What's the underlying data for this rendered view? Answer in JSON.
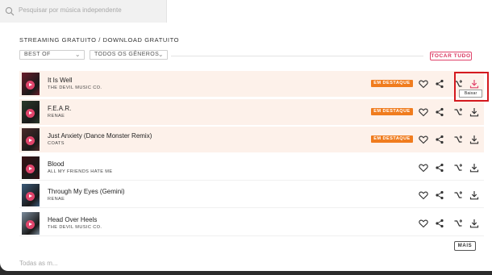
{
  "search": {
    "placeholder": "Pesquisar por música independente"
  },
  "section": {
    "title": "STREAMING GRATUITO / DOWNLOAD GRATUITO"
  },
  "filters": {
    "sort": "BEST OF",
    "genre": "TODOS OS GÊNEROS"
  },
  "play_all_label": "TOCAR TUDO",
  "featured_label": "EM DESTAQUE",
  "tooltip_label": "Baixar",
  "more_label": "MAIS",
  "footer_peek": "Todas as m...",
  "accent_color": "#e0446b",
  "badge_color": "#f07c1e",
  "tracks": [
    {
      "title": "It Is Well",
      "artist": "THE DEVIL MUSIC CO.",
      "featured": true,
      "thumb_color": "#6b1d2a"
    },
    {
      "title": "F.E.A.R.",
      "artist": "RENAE",
      "featured": true,
      "thumb_color": "#2a3a2a"
    },
    {
      "title": "Just Anxiety (Dance Monster Remix)",
      "artist": "COATS",
      "featured": true,
      "thumb_color": "#4a2a2a"
    },
    {
      "title": "Blood",
      "artist": "ALL MY FRIENDS HATE ME",
      "featured": false,
      "thumb_color": "#3a1014"
    },
    {
      "title": "Through My Eyes (Gemini)",
      "artist": "RENAE",
      "featured": false,
      "thumb_color": "#3a5a7a"
    },
    {
      "title": "Head Over Heels",
      "artist": "THE DEVIL MUSIC CO.",
      "featured": false,
      "thumb_color": "#7a8a9a"
    }
  ],
  "icons": {
    "like": "heart-icon",
    "share": "share-icon",
    "remix": "remix-icon",
    "download": "download-icon",
    "search": "search-icon"
  }
}
